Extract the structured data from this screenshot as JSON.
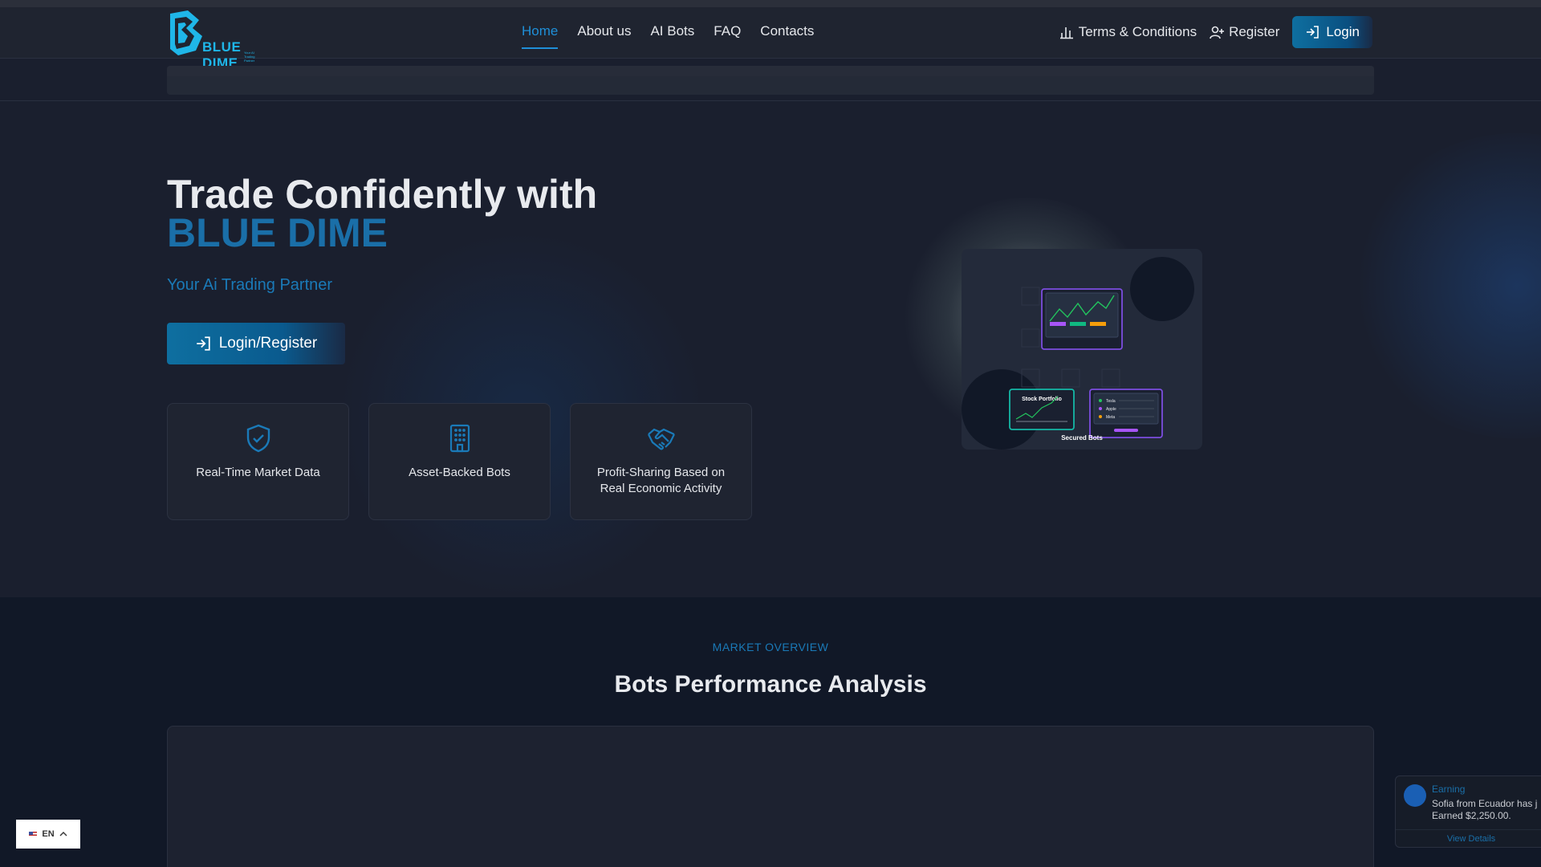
{
  "brand": {
    "name": "BLUE DIME",
    "tagline": "Your AI Trading Partner"
  },
  "nav": {
    "links": [
      "Home",
      "About us",
      "AI Bots",
      "FAQ",
      "Contacts"
    ],
    "terms": "Terms & Conditions",
    "register": "Register",
    "login": "Login"
  },
  "hero": {
    "title": "Trade Confidently with",
    "brand": "BLUE DIME",
    "subtitle": "Your Ai Trading Partner",
    "cta": "Login/Register",
    "features": [
      {
        "icon": "shield-check-icon",
        "label": "Real-Time Market Data"
      },
      {
        "icon": "building-icon",
        "label": "Asset-Backed Bots"
      },
      {
        "icon": "handshake-icon",
        "label": "Profit-Sharing Based on Real Economic Activity"
      }
    ],
    "illustration": {
      "portfolio_label": "Stock Portfolio",
      "legend": [
        "Tesla",
        "Apple",
        "Meta"
      ],
      "caption": "Secured Bots"
    }
  },
  "market": {
    "tag": "MARKET OVERVIEW",
    "title": "Bots Performance Analysis"
  },
  "language": {
    "code": "EN"
  },
  "toast": {
    "title": "Earning",
    "line1": "Sofia from Ecuador has j",
    "line2": "Earned $2,250.00.",
    "link": "View Details"
  },
  "colors": {
    "accent": "#1f8fd8",
    "brand": "#1a6fa8",
    "background": "#1a1f2e"
  }
}
